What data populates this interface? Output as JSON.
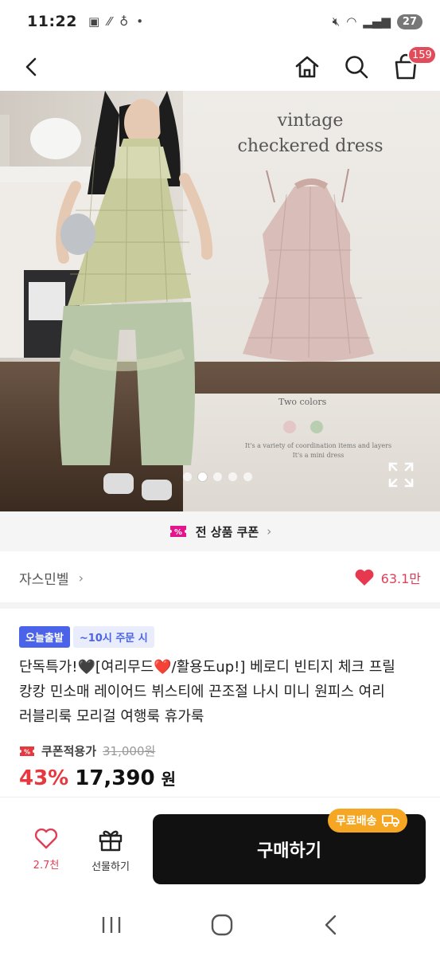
{
  "status_bar": {
    "time": "11:22",
    "battery": "27"
  },
  "nav": {
    "cart_count": "159"
  },
  "hero": {
    "caption_line1": "vintage",
    "caption_line2": "checkered dress",
    "two_colors": "Two colors",
    "note_line1": "It's a variety of coordination items and layers",
    "note_line2": "It's a mini dress",
    "swatch_colors": [
      "#e4c6c6",
      "#b9cdb0"
    ],
    "slide_count": 5,
    "active_slide": 1
  },
  "coupon": {
    "label": "전 상품 쿠폰"
  },
  "store": {
    "name": "자스민벨",
    "likes": "63.1만"
  },
  "tags": {
    "delivery": "오늘출발",
    "cutoff": "~10시 주문 시"
  },
  "product": {
    "title": "단독특가!🖤[여리무드❤️/활용도up!] 베로디 빈티지 체크 프릴 캉캉 민소매 레이어드 뷔스티에 끈조절 나시 미니 원피스 여리 러블리룩 모리걸 여행룩 휴가룩",
    "price_label": "쿠폰적용가",
    "original_price": "31,000원",
    "discount": "43%",
    "final_price": "17,390",
    "currency": "원"
  },
  "bottom_bar": {
    "like_count": "2.7천",
    "gift_label": "선물하기",
    "buy_label": "구매하기",
    "free_shipping": "무료배송"
  },
  "colors": {
    "accent": "#e8383f",
    "like": "#e03e57",
    "tag_blue": "#4a63e8",
    "ship_orange": "#f5a623"
  }
}
